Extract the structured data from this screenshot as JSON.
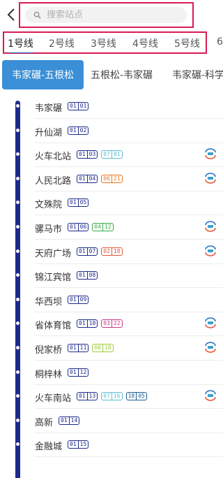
{
  "header": {
    "search_placeholder": "搜索站点"
  },
  "line_tabs": [
    {
      "label": "1号线",
      "active": true
    },
    {
      "label": "2号线",
      "active": false
    },
    {
      "label": "3号线",
      "active": false
    },
    {
      "label": "4号线",
      "active": false
    },
    {
      "label": "5号线",
      "active": false
    },
    {
      "label": "6",
      "active": false
    }
  ],
  "direction_tabs": [
    {
      "label": "韦家碾-五根松",
      "active": true
    },
    {
      "label": "五根松-韦家碾",
      "active": false
    },
    {
      "label": "韦家碾-科学",
      "active": false
    }
  ],
  "colors": {
    "line1": "#1d2a8a",
    "line2": "#e87722",
    "line3": "#d0368a",
    "line4": "#37a846",
    "line7": "#5bbfd6",
    "line18": "#1b5c8f",
    "active_tab": "#3a8fd6",
    "highlight_frame": "#d81b4f"
  },
  "stations": [
    {
      "name": "韦家碾",
      "codes": [
        {
          "line": "01",
          "num": "01",
          "color": "#1d2a8a"
        }
      ],
      "transfer": false
    },
    {
      "name": "升仙湖",
      "codes": [
        {
          "line": "01",
          "num": "02",
          "color": "#1d2a8a"
        }
      ],
      "transfer": false
    },
    {
      "name": "火车北站",
      "codes": [
        {
          "line": "01",
          "num": "03",
          "color": "#1d2a8a"
        },
        {
          "line": "07",
          "num": "01",
          "color": "#5bbfd6"
        }
      ],
      "transfer": true,
      "transfer_icon": "transfer-icon"
    },
    {
      "name": "人民北路",
      "codes": [
        {
          "line": "01",
          "num": "04",
          "color": "#1d2a8a"
        },
        {
          "line": "06",
          "num": "21",
          "color": "#e87722"
        }
      ],
      "transfer": true,
      "transfer_icon": "transfer-icon"
    },
    {
      "name": "文殊院",
      "codes": [
        {
          "line": "01",
          "num": "05",
          "color": "#1d2a8a"
        }
      ],
      "transfer": false
    },
    {
      "name": "骡马市",
      "codes": [
        {
          "line": "01",
          "num": "06",
          "color": "#1d2a8a"
        },
        {
          "line": "04",
          "num": "12",
          "color": "#37a846"
        }
      ],
      "transfer": true,
      "transfer_icon": "transfer-icon"
    },
    {
      "name": "天府广场",
      "codes": [
        {
          "line": "01",
          "num": "07",
          "color": "#1d2a8a"
        },
        {
          "line": "02",
          "num": "18",
          "color": "#e8583a"
        }
      ],
      "transfer": true,
      "transfer_icon": "transfer-icon"
    },
    {
      "name": "锦江宾馆",
      "codes": [
        {
          "line": "01",
          "num": "08",
          "color": "#1d2a8a"
        }
      ],
      "transfer": false
    },
    {
      "name": "华西坝",
      "codes": [
        {
          "line": "01",
          "num": "09",
          "color": "#1d2a8a"
        }
      ],
      "transfer": false
    },
    {
      "name": "省体育馆",
      "codes": [
        {
          "line": "01",
          "num": "10",
          "color": "#1d2a8a"
        },
        {
          "line": "03",
          "num": "22",
          "color": "#d0368a"
        }
      ],
      "transfer": true,
      "transfer_icon": "transfer-icon"
    },
    {
      "name": "倪家桥",
      "codes": [
        {
          "line": "01",
          "num": "11",
          "color": "#1d2a8a"
        },
        {
          "line": "08",
          "num": "18",
          "color": "#9ccc3a"
        }
      ],
      "transfer": true,
      "transfer_icon": "transfer-icon"
    },
    {
      "name": "桐梓林",
      "codes": [
        {
          "line": "01",
          "num": "12",
          "color": "#1d2a8a"
        }
      ],
      "transfer": false
    },
    {
      "name": "火车南站",
      "codes": [
        {
          "line": "01",
          "num": "13",
          "color": "#1d2a8a"
        },
        {
          "line": "07",
          "num": "16",
          "color": "#5bbfd6"
        },
        {
          "line": "18",
          "num": "05",
          "color": "#1b5c8f"
        }
      ],
      "transfer": true,
      "transfer_icon": "transfer-icon"
    },
    {
      "name": "高新",
      "codes": [
        {
          "line": "01",
          "num": "14",
          "color": "#1d2a8a"
        }
      ],
      "transfer": false
    },
    {
      "name": "金融城",
      "codes": [
        {
          "line": "01",
          "num": "15",
          "color": "#1d2a8a"
        }
      ],
      "transfer": false
    }
  ]
}
